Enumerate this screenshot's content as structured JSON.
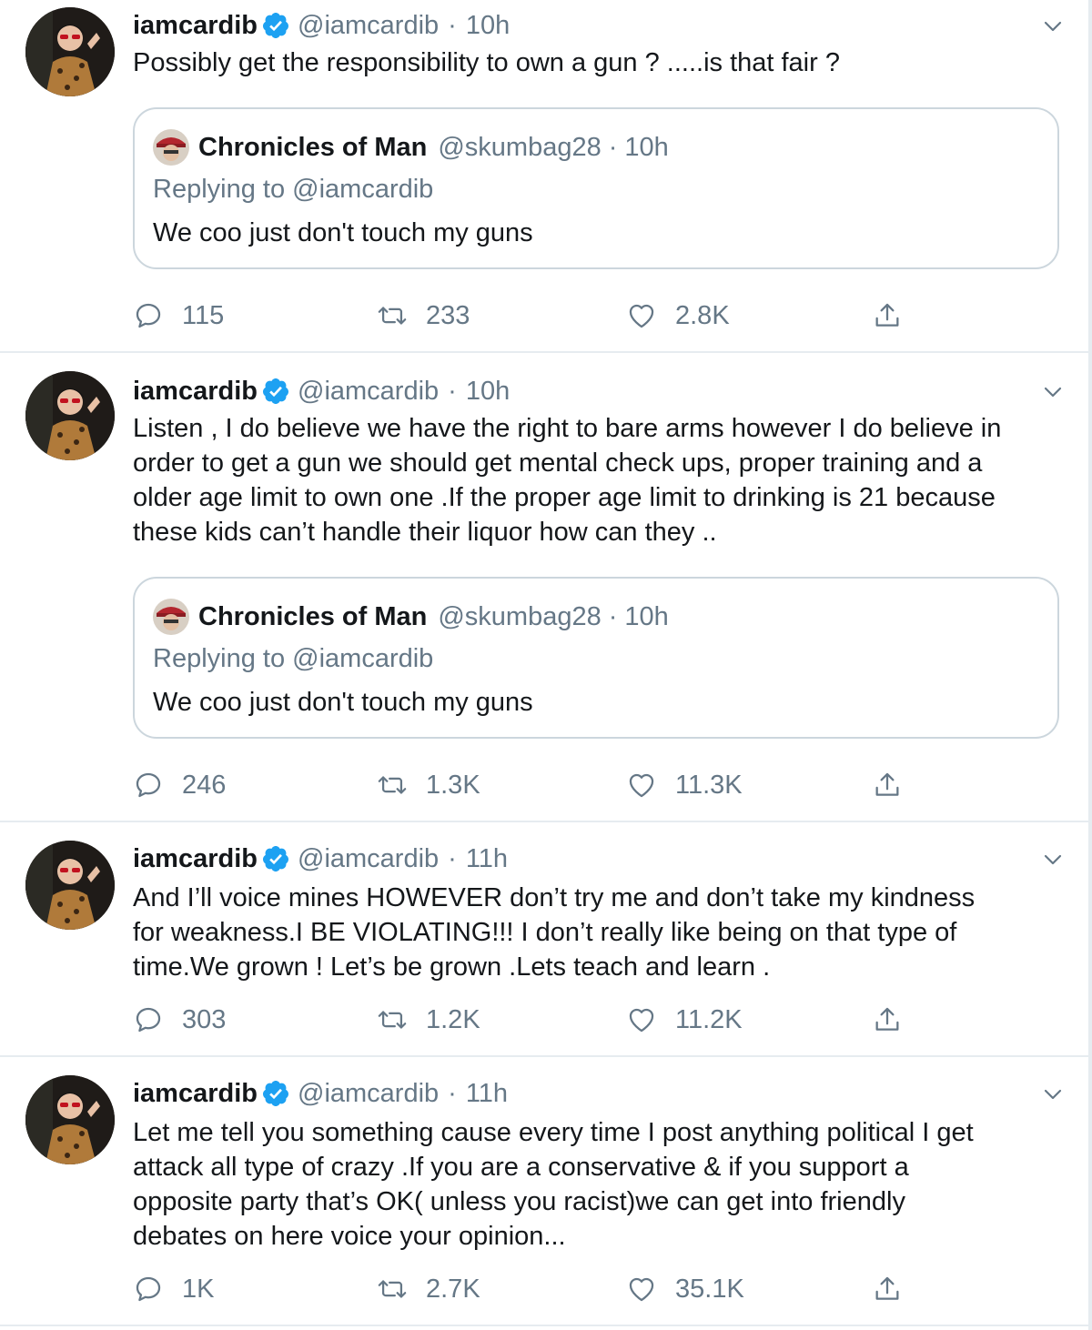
{
  "colors": {
    "text": "#14171a",
    "secondary": "#657786",
    "verified": "#1da1f2",
    "border": "#e6ecf0",
    "quote_border": "#ccd6dd"
  },
  "icons": {
    "verified": "verified-badge-icon",
    "caret": "chevron-down-icon",
    "reply": "reply-bubble-icon",
    "retweet": "retweet-icon",
    "like": "heart-icon",
    "share": "share-upload-icon"
  },
  "tweets": [
    {
      "name": "iamcardib",
      "handle": "@iamcardib",
      "separator": "·",
      "time": "10h",
      "text_lines": [
        "Possibly get the responsibility to own a gun ? .....is that fair ?"
      ],
      "quote": {
        "name": "Chronicles of Man",
        "handle": "@skumbag28",
        "separator": "·",
        "time": "10h",
        "replying_prefix": "Replying to ",
        "replying_to": "@iamcardib",
        "text": "We coo just don't touch my guns"
      },
      "replies": "115",
      "retweets": "233",
      "likes": "2.8K"
    },
    {
      "name": "iamcardib",
      "handle": "@iamcardib",
      "separator": "·",
      "time": "10h",
      "text_lines": [
        "Listen , I do believe we have the right to bare arms however I do believe in",
        "order to get a gun we should get mental check ups, proper training and a",
        "older age limit to own one .If the proper age limit to drinking is 21 because",
        "these kids can’t handle their liquor how can they .."
      ],
      "quote": {
        "name": "Chronicles of Man",
        "handle": "@skumbag28",
        "separator": "·",
        "time": "10h",
        "replying_prefix": "Replying to ",
        "replying_to": "@iamcardib",
        "text": "We coo just don't touch my guns"
      },
      "replies": "246",
      "retweets": "1.3K",
      "likes": "11.3K"
    },
    {
      "name": "iamcardib",
      "handle": "@iamcardib",
      "separator": "·",
      "time": "11h",
      "text_lines": [
        "And I’ll voice mines HOWEVER don’t try me and don’t take my kindness",
        "for weakness.I BE VIOLATING!!! I don’t really like being on that type of",
        "time.We grown ! Let’s be grown .Lets teach and learn ."
      ],
      "replies": "303",
      "retweets": "1.2K",
      "likes": "11.2K"
    },
    {
      "name": "iamcardib",
      "handle": "@iamcardib",
      "separator": "·",
      "time": "11h",
      "text_lines": [
        "Let me tell you something cause every time I post anything political I get",
        "attack all type of crazy .If you are a conservative & if you support a",
        "opposite party that’s OK( unless you racist)we can get into friendly",
        "debates on here voice your opinion..."
      ],
      "replies": "1K",
      "retweets": "2.7K",
      "likes": "35.1K"
    }
  ]
}
